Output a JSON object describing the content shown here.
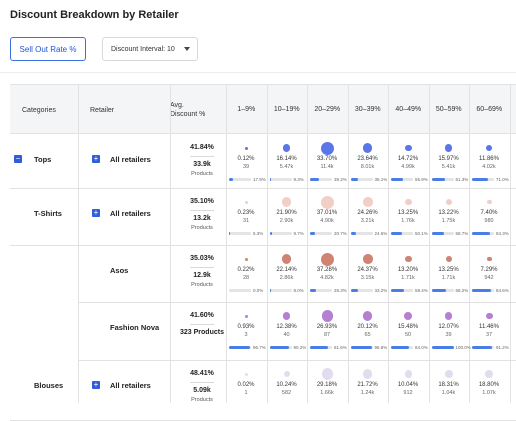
{
  "title": "Discount Breakdown by Retailer",
  "toolbar": {
    "primary_button": "Sell Out Rate %",
    "interval_label": "Discount Interval: 10"
  },
  "columns": {
    "categories": "Categories",
    "retailer": "Retailer",
    "avg_line1": "Avg.",
    "avg_line2": "Discount %"
  },
  "bins": [
    "1–9%",
    "10–19%",
    "20–29%",
    "30–39%",
    "40–49%",
    "50–59%",
    "60–69%"
  ],
  "rows": [
    {
      "category": "Tops",
      "category_toggle": "−",
      "retailer": "All retailers",
      "retailer_toggle": "+",
      "avg": "41.84%",
      "products": "33.9k",
      "products_label": "Products",
      "dot_color": "#5a76e8",
      "cells": [
        {
          "pct": "0.12%",
          "count": "39",
          "cum": "17.9%",
          "size": 0.12,
          "fill": 0.18
        },
        {
          "pct": "16.14%",
          "count": "5.47k",
          "cum": "9.3%",
          "size": 0.55,
          "fill": 0.09
        },
        {
          "pct": "33.70%",
          "count": "11.4k",
          "cum": "39.2%",
          "size": 1.0,
          "fill": 0.39
        },
        {
          "pct": "23.64%",
          "count": "8.01k",
          "cum": "35.1%",
          "size": 0.71,
          "fill": 0.35
        },
        {
          "pct": "14.72%",
          "count": "4.99k",
          "cum": "55.9%",
          "size": 0.52,
          "fill": 0.56
        },
        {
          "pct": "15.97%",
          "count": "5.41k",
          "cum": "61.3%",
          "size": 0.55,
          "fill": 0.61
        },
        {
          "pct": "11.86%",
          "count": "4.02k",
          "cum": "71.0%",
          "size": 0.45,
          "fill": 0.71
        }
      ]
    },
    {
      "category": "T-Shirts",
      "category_toggle": "",
      "retailer": "All retailers",
      "retailer_toggle": "+",
      "avg": "35.10%",
      "products": "13.2k",
      "products_label": "Products",
      "dot_color": "#f2cfc6",
      "cells": [
        {
          "pct": "0.23%",
          "count": "31",
          "cum": "5.3%",
          "size": 0.12,
          "fill": 0.05
        },
        {
          "pct": "21.90%",
          "count": "2.90k",
          "cum": "9.7%",
          "size": 0.7,
          "fill": 0.1
        },
        {
          "pct": "37.01%",
          "count": "4.90k",
          "cum": "20.7%",
          "size": 1.0,
          "fill": 0.21
        },
        {
          "pct": "24.26%",
          "count": "3.21k",
          "cum": "24.6%",
          "size": 0.74,
          "fill": 0.25
        },
        {
          "pct": "13.25%",
          "count": "1.76k",
          "cum": "50.1%",
          "size": 0.5,
          "fill": 0.5
        },
        {
          "pct": "13.22%",
          "count": "1.75k",
          "cum": "58.7%",
          "size": 0.5,
          "fill": 0.59
        },
        {
          "pct": "7.40%",
          "count": "980",
          "cum": "84.3%",
          "size": 0.35,
          "fill": 0.84
        }
      ]
    },
    {
      "category": "",
      "category_toggle": "",
      "retailer": "Asos",
      "retailer_toggle": "",
      "avg": "35.03%",
      "products": "12.9k",
      "products_label": "Products",
      "dot_color": "#d08373",
      "cells": [
        {
          "pct": "0.22%",
          "count": "28",
          "cum": "0.0%",
          "size": 0.12,
          "fill": 0.0
        },
        {
          "pct": "22.14%",
          "count": "2.86k",
          "cum": "8.0%",
          "size": 0.7,
          "fill": 0.08
        },
        {
          "pct": "37.28%",
          "count": "4.82k",
          "cum": "28.3%",
          "size": 1.0,
          "fill": 0.28
        },
        {
          "pct": "24.37%",
          "count": "3.15k",
          "cum": "33.2%",
          "size": 0.74,
          "fill": 0.33
        },
        {
          "pct": "13.20%",
          "count": "1.71k",
          "cum": "59.4%",
          "size": 0.5,
          "fill": 0.59
        },
        {
          "pct": "13.25%",
          "count": "1.71k",
          "cum": "68.2%",
          "size": 0.5,
          "fill": 0.68
        },
        {
          "pct": "7.29%",
          "count": "942",
          "cum": "84.6%",
          "size": 0.35,
          "fill": 0.85
        }
      ]
    },
    {
      "category": "",
      "category_toggle": "",
      "retailer": "Fashion Nova",
      "retailer_toggle": "",
      "avg": "41.60%",
      "products": "323 Products",
      "products_label": "",
      "dot_color": "#b57fd2",
      "cells": [
        {
          "pct": "0.93%",
          "count": "3",
          "cum": "96.7%",
          "size": 0.15,
          "fill": 0.97
        },
        {
          "pct": "12.38%",
          "count": "40",
          "cum": "90.2%",
          "size": 0.55,
          "fill": 0.9
        },
        {
          "pct": "26.93%",
          "count": "87",
          "cum": "81.6%",
          "size": 0.85,
          "fill": 0.82
        },
        {
          "pct": "20.12%",
          "count": "65",
          "cum": "96.8%",
          "size": 0.7,
          "fill": 0.97
        },
        {
          "pct": "15.48%",
          "count": "50",
          "cum": "84.0%",
          "size": 0.6,
          "fill": 0.84
        },
        {
          "pct": "12.07%",
          "count": "39",
          "cum": "100.0%",
          "size": 0.55,
          "fill": 1.0
        },
        {
          "pct": "11.46%",
          "count": "37",
          "cum": "91.2%",
          "size": 0.52,
          "fill": 0.91
        }
      ]
    },
    {
      "category": "Blouses",
      "category_toggle": "",
      "retailer": "All retailers",
      "retailer_toggle": "+",
      "avg": "48.41%",
      "products": "5.09k",
      "products_label": "Products",
      "dot_color": "#e3dcef",
      "cells": [
        {
          "pct": "0.02%",
          "count": "1",
          "cum": "",
          "size": 0.1,
          "fill": 0
        },
        {
          "pct": "10.24%",
          "count": "582",
          "cum": "",
          "size": 0.5,
          "fill": 0
        },
        {
          "pct": "29.18%",
          "count": "1.66k",
          "cum": "",
          "size": 0.85,
          "fill": 0
        },
        {
          "pct": "21.72%",
          "count": "1.24k",
          "cum": "",
          "size": 0.7,
          "fill": 0
        },
        {
          "pct": "10.04%",
          "count": "912",
          "cum": "",
          "size": 0.55,
          "fill": 0
        },
        {
          "pct": "18.31%",
          "count": "1.04k",
          "cum": "",
          "size": 0.6,
          "fill": 0
        },
        {
          "pct": "18.80%",
          "count": "1.07k",
          "cum": "",
          "size": 0.6,
          "fill": 0
        }
      ]
    }
  ]
}
